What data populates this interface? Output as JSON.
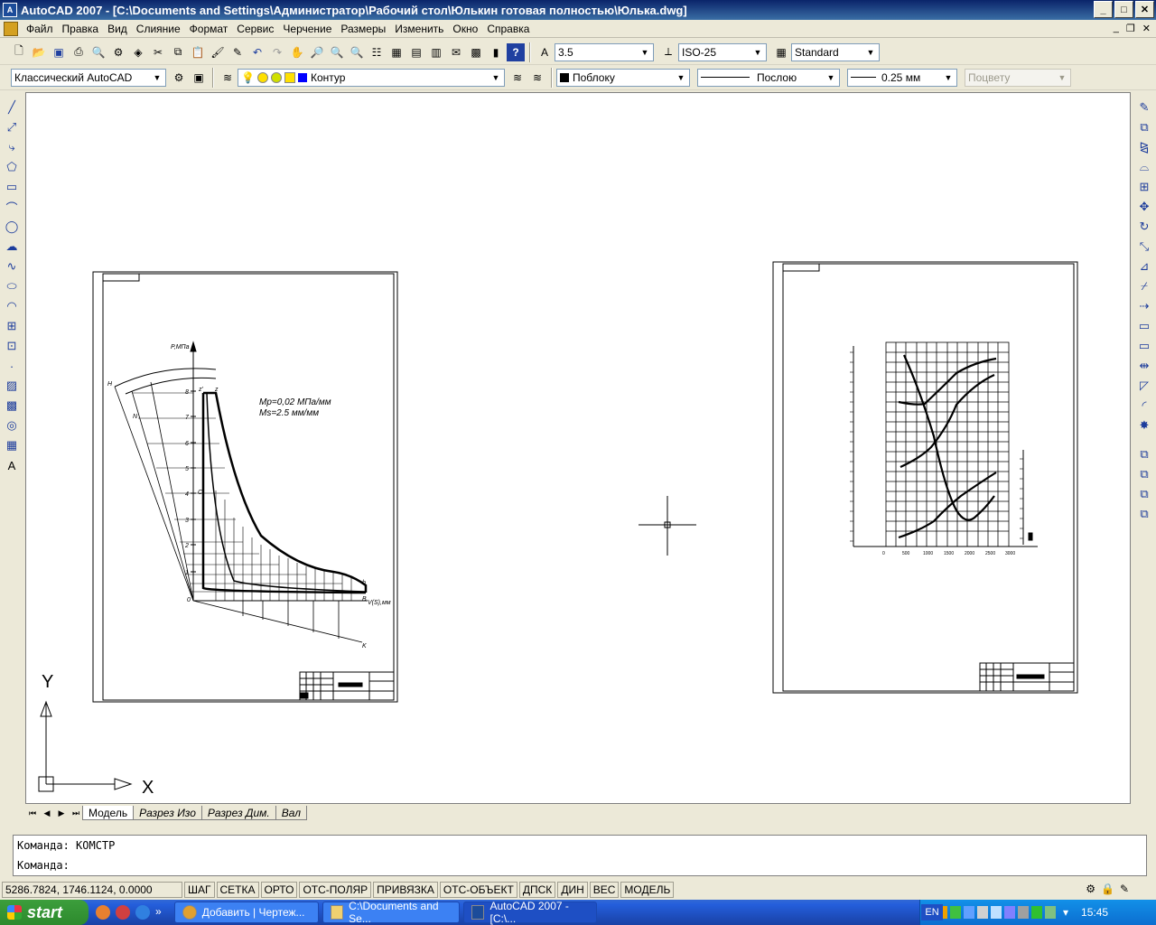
{
  "window": {
    "title": "AutoCAD 2007 - [C:\\Documents and Settings\\Администратор\\Рабочий стол\\Юлькин готовая полностью\\Юлька.dwg]",
    "minimize": "_",
    "maximize": "□",
    "close": "✕"
  },
  "menu": [
    "Файл",
    "Правка",
    "Вид",
    "Слияние",
    "Формат",
    "Сервис",
    "Черчение",
    "Размеры",
    "Изменить",
    "Окно",
    "Справка"
  ],
  "toolbar": {
    "text_height": "3.5",
    "dim_style": "ISO-25",
    "table_style": "Standard",
    "workspace": "Классический AutoCAD",
    "layer": "Контур",
    "color": "Поблоку",
    "linetype": "Послою",
    "lineweight": "0.25 мм",
    "plot_style": "Поцвету"
  },
  "tabs": [
    "Модель",
    "Разрез Изо",
    "Разрез Дим.",
    "Вал"
  ],
  "command": {
    "history": "Команда: КОМСТР",
    "prompt": "Команда:"
  },
  "status": {
    "coords": "5286.7824, 1746.1124, 0.0000",
    "buttons": [
      "ШАГ",
      "СЕТКА",
      "ОРТО",
      "ОТС-ПОЛЯР",
      "ПРИВЯЗКА",
      "ОТС-ОБЪЕКТ",
      "ДПСК",
      "ДИН",
      "ВЕС",
      "МОДЕЛЬ"
    ]
  },
  "ucs": {
    "y": "Y",
    "x": "X"
  },
  "drawing_left": {
    "axis_label_p": "P,МПа",
    "axis_label_v": "V(S),мм",
    "scale_p": "Mp=0,02 МПа/мм",
    "scale_v": "Ms=2.5 мм/мм",
    "y_ticks": [
      "8",
      "7",
      "6",
      "5",
      "4",
      "3",
      "2",
      "1",
      "0"
    ],
    "point_labels": [
      "H",
      "N",
      "z'",
      "z",
      "C",
      "b",
      "B",
      "K"
    ]
  },
  "drawing_right": {
    "x_ticks": [
      "0",
      "500",
      "1000",
      "1500",
      "2000",
      "2500",
      "3000"
    ]
  },
  "taskbar": {
    "start": "start",
    "tasks": [
      "Добавить | Чертеж...",
      "C:\\Documents and Se...",
      "AutoCAD 2007 - [C:\\..."
    ],
    "lang": "EN",
    "clock": "15:45",
    "more": "»"
  },
  "colors": {
    "title_bg": "#0a246a",
    "ui_face": "#ece9d8",
    "taskbar": "#245edb",
    "start": "#3c9e3c"
  }
}
